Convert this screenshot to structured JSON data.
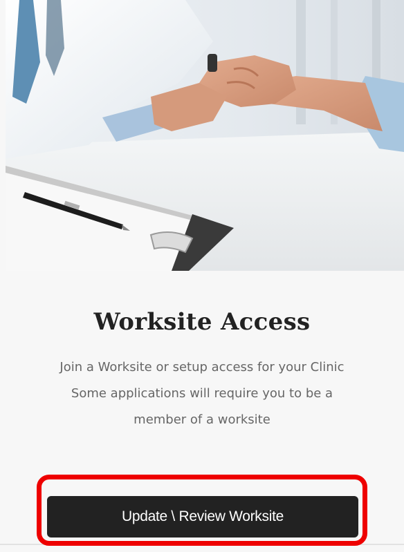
{
  "card": {
    "image_alt": "doctor-holding-patient-hand-photo",
    "title": "Worksite Access",
    "description_lines": [
      "Join a Worksite or setup access for your Clinic",
      "Some applications will require you to be a",
      "member of a worksite"
    ],
    "button_label": "Update \\ Review Worksite"
  },
  "colors": {
    "button_bg": "#222222",
    "button_text": "#ffffff",
    "highlight": "#ee0000",
    "title": "#222222",
    "description": "#666666"
  }
}
